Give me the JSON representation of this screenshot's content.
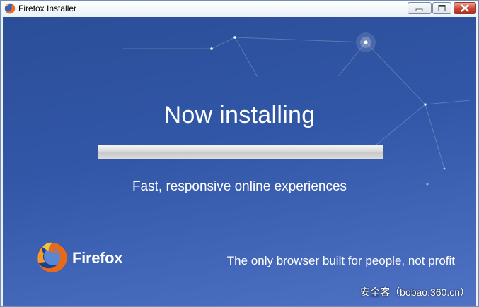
{
  "window": {
    "title": "Firefox Installer",
    "app_icon": "firefox-icon",
    "controls": {
      "minimize_icon": "minimize-icon",
      "maximize_icon": "maximize-icon",
      "close_icon": "close-icon"
    }
  },
  "installer": {
    "headline": "Now installing",
    "progress": 1.0,
    "tagline": "Fast, responsive online experiences",
    "brand_name": "Firefox",
    "brand_icon": "firefox-logo-icon",
    "slogan": "The only browser built for people, not profit"
  },
  "watermark": "安全客（bobao.360.cn）",
  "colors": {
    "background_top": "#2b4e98",
    "background_bottom": "#4f72c4",
    "text": "#ffffff",
    "close_button": "#c9483a"
  }
}
